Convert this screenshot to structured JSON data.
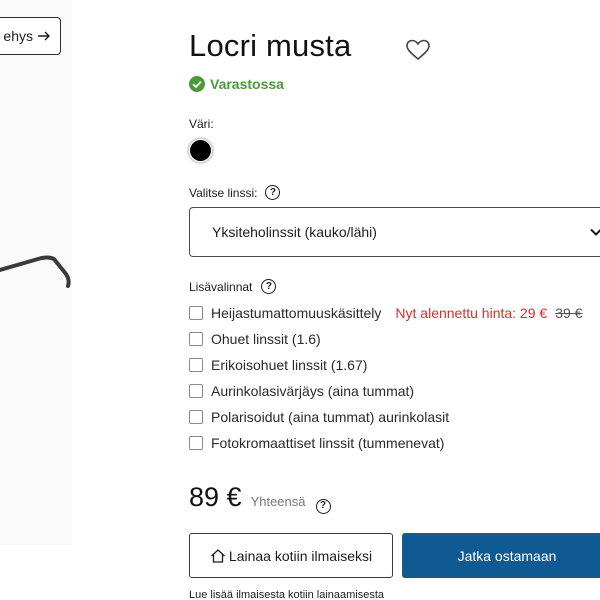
{
  "image_area": {
    "frame_button_label": "ehys"
  },
  "product": {
    "title": "Locri musta",
    "stock_status": "Varastossa",
    "color_label": "Väri:",
    "selected_color": "#000000",
    "lens_label": "Valitse linssi:",
    "lens_selected": "Yksiteholinssit (kauko/lähi)",
    "extras_label": "Lisävalinnat",
    "options": [
      {
        "label": "Heijastumattomuuskäsittely",
        "sale_text": "Nyt alennettu hinta: 29 €",
        "old_price": "39 €",
        "checked": false
      },
      {
        "label": "Ohuet linssit (1.6)",
        "checked": false
      },
      {
        "label": "Erikoisohuet linssit (1.67)",
        "checked": false
      },
      {
        "label": "Aurinkolasivärjäys (aina tummat)",
        "checked": false
      },
      {
        "label": "Polarisoidut (aina tummat) aurinkolasit",
        "checked": false
      },
      {
        "label": "Fotokromaattiset linssit (tummenevat)",
        "checked": false
      }
    ],
    "price": "89 €",
    "total_label": "Yhteensä",
    "loan_button": "Lainaa kotiin ilmaiseksi",
    "continue_button": "Jatka ostamaan",
    "loan_link": "Lue lisää ilmaisesta kotiin lainaamisesta"
  },
  "colors": {
    "accent": "#0f5a92",
    "in_stock": "#4a9a3a",
    "sale": "#d32f2f"
  }
}
